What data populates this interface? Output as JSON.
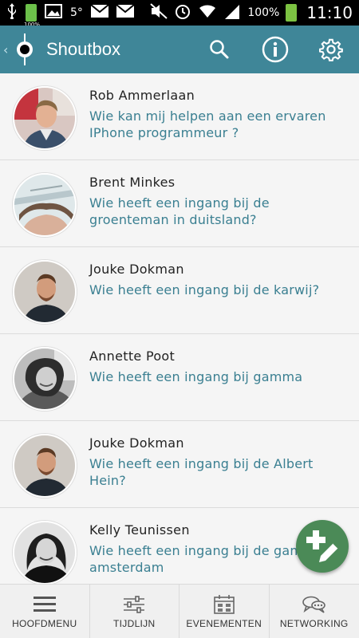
{
  "status_bar": {
    "notif_temp": "5°",
    "battery_small_label": "100%",
    "battery_percent": "100%",
    "time": "11:10"
  },
  "app_bar": {
    "title": "Shoutbox",
    "back_glyph": "‹",
    "actions": [
      "search-icon",
      "info-icon",
      "settings-icon"
    ],
    "color": "#3f8698"
  },
  "shouts": [
    {
      "name": "Rob  Ammerlaan",
      "message": "Wie kan mij helpen aan een ervaren IPhone programmeur ?"
    },
    {
      "name": "Brent  Minkes",
      "message": "Wie heeft een ingang bij de groenteman in duitsland?"
    },
    {
      "name": "Jouke  Dokman",
      "message": "Wie heeft een ingang bij de karwij?"
    },
    {
      "name": "Annette  Poot",
      "message": "Wie heeft een ingang bij gamma"
    },
    {
      "name": "Jouke  Dokman",
      "message": "Wie heeft een ingang bij de Albert Hein?"
    },
    {
      "name": "Kelly  Teunissen",
      "message": "Wie heeft een ingang bij de gamma in amsterdam"
    }
  ],
  "fab": {
    "icon": "add-compose-icon",
    "color": "#4b8a57"
  },
  "bottom_nav": [
    {
      "label": "HOOFDMENU",
      "icon": "menu-icon"
    },
    {
      "label": "TIJDLIJN",
      "icon": "sliders-icon"
    },
    {
      "label": "EVENEMENTEN",
      "icon": "calendar-icon"
    },
    {
      "label": "NETWORKING",
      "icon": "chat-icon"
    }
  ],
  "colors": {
    "accent": "#3f8698",
    "message_text": "#3a7f91",
    "fab": "#4b8a57"
  }
}
